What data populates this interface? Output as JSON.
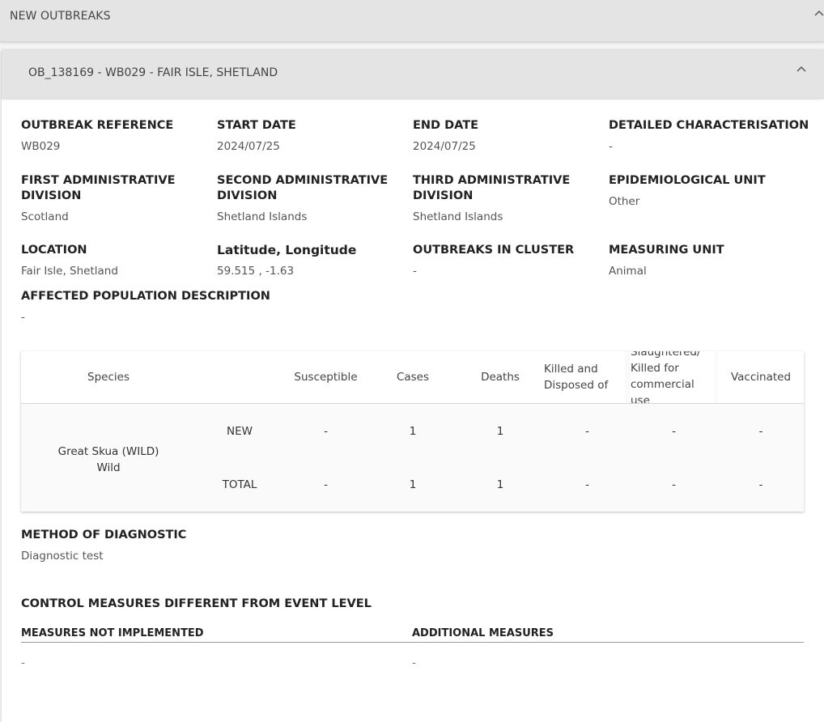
{
  "top_panel": {
    "title": "NEW OUTBREAKS"
  },
  "outbreak": {
    "title": "OB_138169 - WB029 - FAIR ISLE, SHETLAND",
    "fields": {
      "outbreak_reference": {
        "label": "OUTBREAK REFERENCE",
        "value": "WB029"
      },
      "start_date": {
        "label": "START DATE",
        "value": "2024/07/25"
      },
      "end_date": {
        "label": "END DATE",
        "value": "2024/07/25"
      },
      "detailed_characterisation": {
        "label": "DETAILED CHARACTERISATION",
        "value": "-"
      },
      "first_admin": {
        "label": "FIRST ADMINISTRATIVE DIVISION",
        "value": "Scotland"
      },
      "second_admin": {
        "label": "SECOND ADMINISTRATIVE DIVISION",
        "value": "Shetland Islands"
      },
      "third_admin": {
        "label": "THIRD ADMINISTRATIVE DIVISION",
        "value": "Shetland Islands"
      },
      "epi_unit": {
        "label": "EPIDEMIOLOGICAL UNIT",
        "value": "Other"
      },
      "location": {
        "label": "LOCATION",
        "value": "Fair Isle, Shetland"
      },
      "lat_lon": {
        "label": "Latitude, Longitude",
        "value": "59.515 , -1.63"
      },
      "outbreaks_in_cluster": {
        "label": "OUTBREAKS IN CLUSTER",
        "value": "-"
      },
      "measuring_unit": {
        "label": "MEASURING UNIT",
        "value": "Animal"
      },
      "affected_population": {
        "label": "AFFECTED POPULATION DESCRIPTION",
        "value": "-"
      }
    },
    "table": {
      "headers": {
        "species": "Species",
        "susceptible": "Susceptible",
        "cases": "Cases",
        "deaths": "Deaths",
        "killed": "Killed and Disposed of",
        "slaughtered": "Slaughtered/ Killed for commercial use",
        "vaccinated": "Vaccinated"
      },
      "species_name": "Great Skua (WILD)",
      "species_type": "Wild",
      "rows": [
        {
          "label": "NEW",
          "susceptible": "-",
          "cases": "1",
          "deaths": "1",
          "killed": "-",
          "slaughtered": "-",
          "vaccinated": "-"
        },
        {
          "label": "TOTAL",
          "susceptible": "-",
          "cases": "1",
          "deaths": "1",
          "killed": "-",
          "slaughtered": "-",
          "vaccinated": "-"
        }
      ]
    },
    "method": {
      "label": "METHOD OF DIAGNOSTIC",
      "value": "Diagnostic test"
    },
    "control": {
      "title": "CONTROL MEASURES DIFFERENT FROM EVENT LEVEL",
      "not_implemented_label": "MEASURES NOT IMPLEMENTED",
      "not_implemented_value": "-",
      "additional_label": "ADDITIONAL MEASURES",
      "additional_value": "-"
    }
  },
  "colors": {
    "panel_header": "#e4e4e4",
    "card_bg": "#ffffff",
    "table_bg": "#fafafa"
  }
}
